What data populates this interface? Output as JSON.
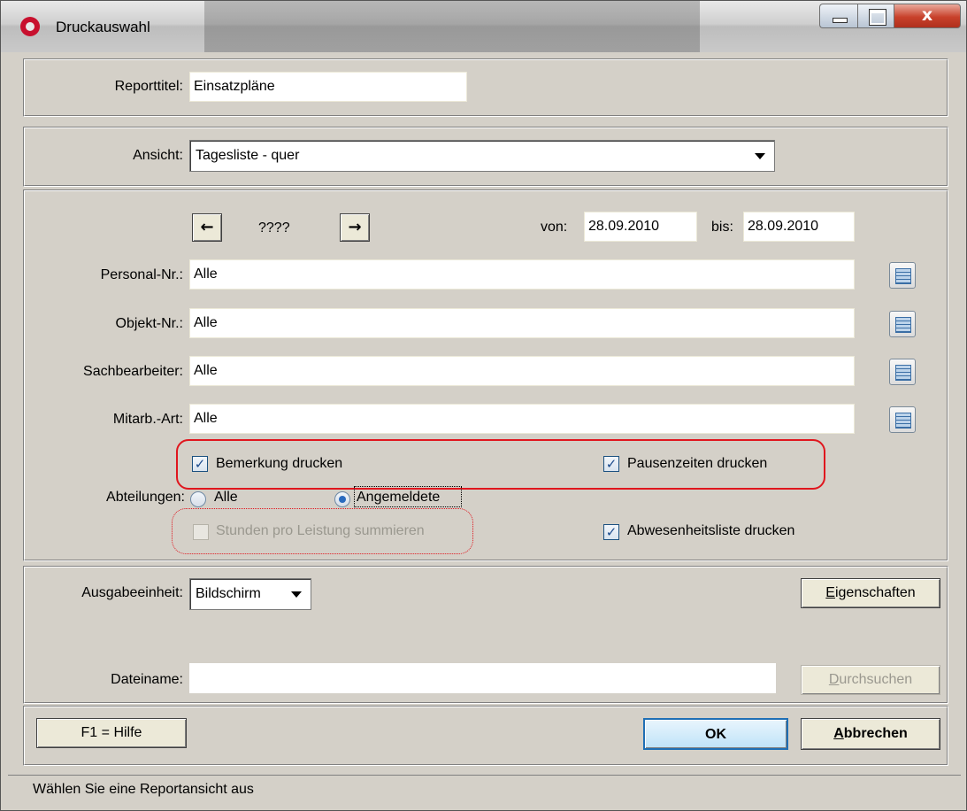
{
  "window": {
    "title": "Druckauswahl",
    "close_glyph": "x"
  },
  "report": {
    "title_label": "Reporttitel:",
    "title_value": "Einsatzpläne"
  },
  "view": {
    "label": "Ansicht:",
    "value": "Tagesliste - quer"
  },
  "period": {
    "prev_glyph": "←",
    "next_glyph": "→",
    "placeholder": "????",
    "from_label": "von:",
    "from_value": "28.09.2010",
    "to_label": "bis:",
    "to_value": "28.09.2010"
  },
  "filters": [
    {
      "label": "Personal-Nr.:",
      "value": "Alle"
    },
    {
      "label": "Objekt-Nr.:",
      "value": "Alle"
    },
    {
      "label": "Sachbearbeiter:",
      "value": "Alle"
    },
    {
      "label": "Mitarb.-Art:",
      "value": "Alle"
    }
  ],
  "options": {
    "bemerkung": {
      "label": "Bemerkung drucken",
      "checked": true
    },
    "pausen": {
      "label": "Pausenzeiten drucken",
      "checked": true
    },
    "abwesenheit": {
      "label": "Abwesenheitsliste drucken",
      "checked": true
    },
    "stunden": {
      "label": "Stunden pro Leistung summieren",
      "checked": false,
      "enabled": false
    }
  },
  "abteilungen": {
    "label": "Abteilungen:",
    "opt_all": "Alle",
    "opt_logged": "Angemeldete",
    "selected": "Angemeldete"
  },
  "output": {
    "unit_label": "Ausgabeeinheit:",
    "unit_value": "Bildschirm",
    "properties_button": {
      "accel": "E",
      "rest": "igenschaften"
    },
    "filename_label": "Dateiname:",
    "filename_value": "",
    "browse_button": {
      "accel": "D",
      "rest": "urchsuchen"
    }
  },
  "footer": {
    "help_button": "F1 = Hilfe",
    "ok_button": "OK",
    "cancel_button": {
      "accel": "A",
      "rest": "bbrechen"
    }
  },
  "status_text": "Wählen Sie eine Reportansicht aus"
}
